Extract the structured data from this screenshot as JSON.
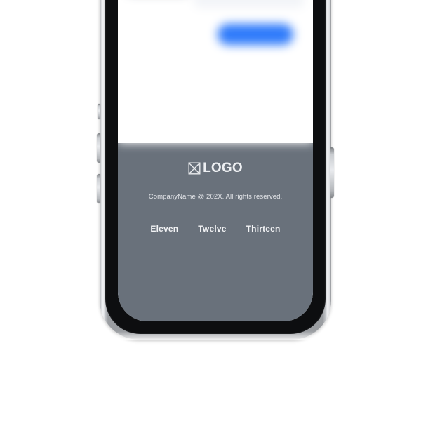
{
  "background_color": "#ffffff",
  "device": {
    "type": "smartphone-mockup",
    "frame_color": "#9a9da1",
    "bezel_color": "#0d0e10",
    "screen_color": "#ffffff",
    "side_buttons": [
      {
        "name": "mute-switch",
        "side": "left"
      },
      {
        "name": "volume-up-button",
        "side": "left"
      },
      {
        "name": "volume-down-button",
        "side": "left"
      },
      {
        "name": "power-button",
        "side": "right"
      }
    ]
  },
  "content": {
    "blurred_form": {
      "blurred": true,
      "rows": 5,
      "label_color": "#c3c7cf",
      "input_color": "#f2f4f8",
      "submit_button": {
        "color": "#2f7bfb",
        "shape": "rounded-pill"
      }
    }
  },
  "footer": {
    "background_color": "#69717b",
    "text_color": "#edeff2",
    "logo": {
      "icon": "crossed-box-icon",
      "label": "LOGO"
    },
    "copyright": "CompanyName @ 202X. All rights reserved.",
    "links": [
      {
        "label": "Eleven"
      },
      {
        "label": "Twelve"
      },
      {
        "label": "Thirteen"
      }
    ]
  }
}
